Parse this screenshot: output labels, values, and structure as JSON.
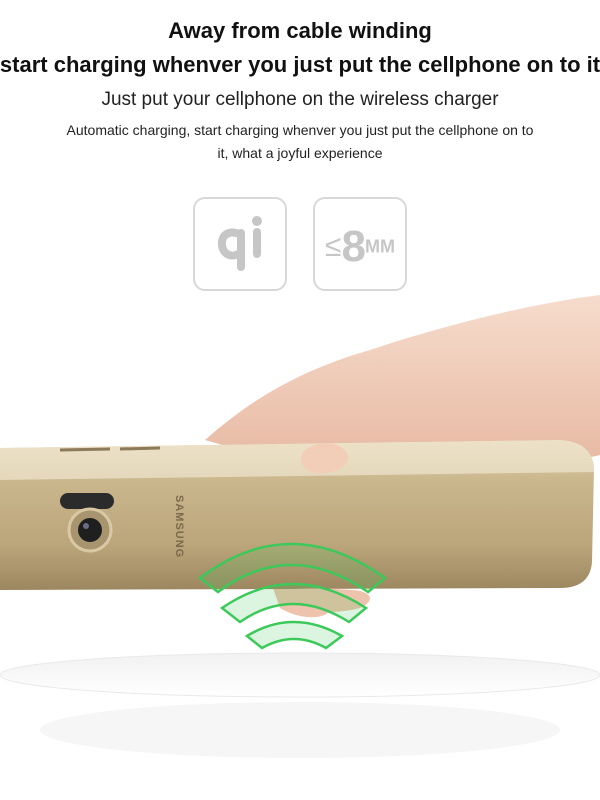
{
  "header": {
    "title": "Away from cable winding",
    "subtitle": "start charging whenver you just put the cellphone on to it",
    "lead": "Just put your cellphone on the wireless charger",
    "description": "Automatic charging, start charging whenver you just put the cellphone on to it, what a joyful experience"
  },
  "badges": {
    "qi_icon": "qi-logo-icon",
    "distance": {
      "symbol": "≤",
      "value": "8",
      "unit": "MM"
    }
  },
  "product": {
    "brand": "SAMSUNG"
  },
  "colors": {
    "wave_green": "#3cc95a",
    "phone_gold": "#c9b68f",
    "badge_border": "#d8d8d8"
  }
}
